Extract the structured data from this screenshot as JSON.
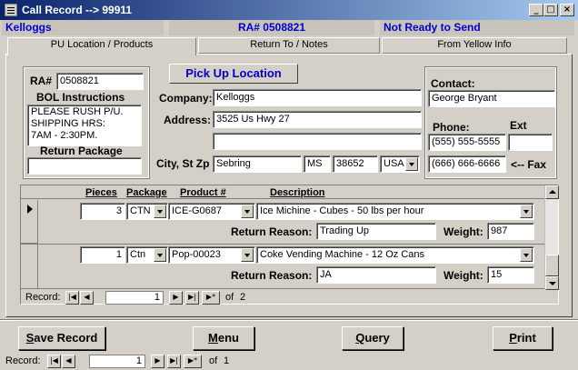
{
  "window": {
    "title": "Call Record --> 99911"
  },
  "infobar": {
    "customer": "Kelloggs",
    "ra_display": "RA# 0508821",
    "status": "Not Ready to Send"
  },
  "tabs": [
    "PU Location / Products",
    "Return To / Notes",
    "From Yellow Info"
  ],
  "left": {
    "ra_label": "RA#",
    "ra_value": "0508821",
    "bol_label": "BOL Instructions",
    "bol_text": "PLEASE RUSH P/U.\nSHIPPING HRS:\n7AM - 2:30PM.",
    "return_package_label": "Return Package",
    "return_package_value": ""
  },
  "pickup": {
    "button_label": "Pick Up Location",
    "company_label": "Company:",
    "company": "Kelloggs",
    "address_label": "Address:",
    "address1": "3525 Us Hwy 27",
    "address2": "",
    "city_label": "City, St Zp",
    "city": "Sebring",
    "state": "MS",
    "zip": "38652",
    "country": "USA"
  },
  "contact": {
    "label": "Contact:",
    "name": "George Bryant",
    "phone_label": "Phone:",
    "ext_label": "Ext",
    "phone": "(555) 555-5555",
    "ext": "",
    "fax": "(666) 666-6666",
    "fax_label": "<-- Fax"
  },
  "products": {
    "headers": {
      "pieces": "Pieces",
      "package": "Package",
      "product": "Product #",
      "description": "Description"
    },
    "return_reason_label": "Return Reason:",
    "weight_label": "Weight:",
    "rows": [
      {
        "pieces": "3",
        "package": "CTN",
        "product": "ICE-G0687",
        "description": "Ice Michine - Cubes  - 50 lbs per hour",
        "reason": "Trading Up",
        "weight": "987"
      },
      {
        "pieces": "1",
        "package": "Ctn",
        "product": "Pop-00023",
        "description": "Coke Vending Machine - 12 Oz Cans",
        "reason": "JA",
        "weight": "15"
      }
    ],
    "nav": {
      "label": "Record:",
      "current": "1",
      "of_label": "of",
      "total": "2"
    }
  },
  "buttons": {
    "save": "Save Record",
    "menu": "Menu",
    "query": "Query",
    "print": "Print"
  },
  "form_nav": {
    "label": "Record:",
    "current": "1",
    "of_label": "of",
    "total": "1"
  },
  "nav_glyphs": {
    "first": "|◀",
    "prev": "◀",
    "next": "▶",
    "last": "▶|",
    "new": "▶*"
  },
  "window_glyphs": {
    "minimize": "_",
    "maximize": "□",
    "close": "×"
  },
  "icons": {
    "window": "form-icon",
    "record_selector": "row-pointer-icon"
  }
}
